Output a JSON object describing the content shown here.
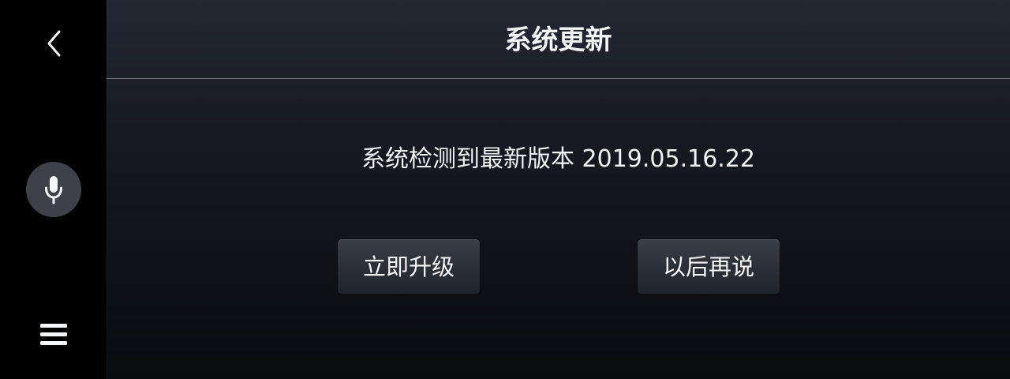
{
  "sidebar": {
    "back_icon": "chevron-left-icon",
    "voice_icon": "microphone-icon",
    "menu_icon": "menu-icon"
  },
  "header": {
    "title": "系统更新"
  },
  "main": {
    "message": "系统检测到最新版本 2019.05.16.22",
    "actions": {
      "upgrade_label": "立即升级",
      "later_label": "以后再说"
    }
  },
  "colors": {
    "rail": "#000000",
    "panel_top": "#242833",
    "panel_bottom": "#090b0f",
    "text": "#f4f5f7",
    "button": "#2c3038",
    "divider": "#747982",
    "voice_button": "#3e4147"
  }
}
